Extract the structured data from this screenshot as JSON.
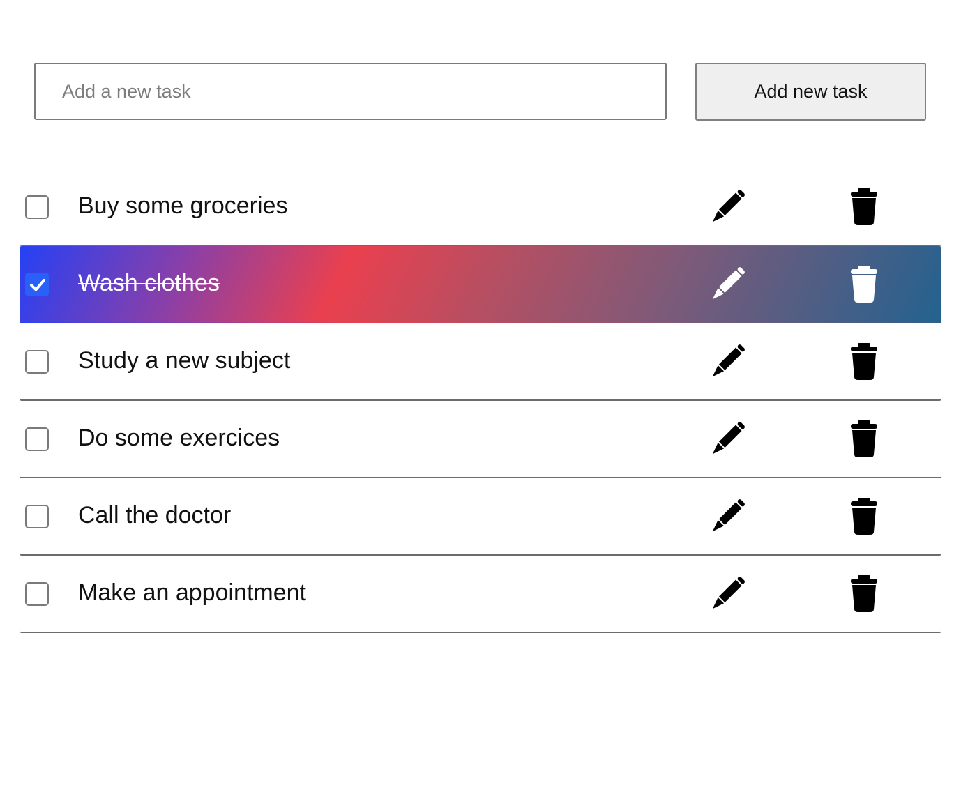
{
  "new_task": {
    "placeholder": "Add a new task",
    "value": "",
    "button_label": "Add new task"
  },
  "tasks": [
    {
      "label": "Buy some groceries",
      "done": false
    },
    {
      "label": "Wash clothes",
      "done": true
    },
    {
      "label": "Study a new subject",
      "done": false
    },
    {
      "label": "Do some exercices",
      "done": false
    },
    {
      "label": "Call the doctor",
      "done": false
    },
    {
      "label": "Make an appointment",
      "done": false
    }
  ],
  "icons": {
    "edit": "pencil-icon",
    "delete": "trash-icon",
    "check": "checkmark-icon"
  },
  "colors": {
    "checkbox_checked": "#2860f8",
    "done_gradient": [
      "#2541f5",
      "#ea404e",
      "#23628f"
    ],
    "divider": "#6b6b6b"
  }
}
